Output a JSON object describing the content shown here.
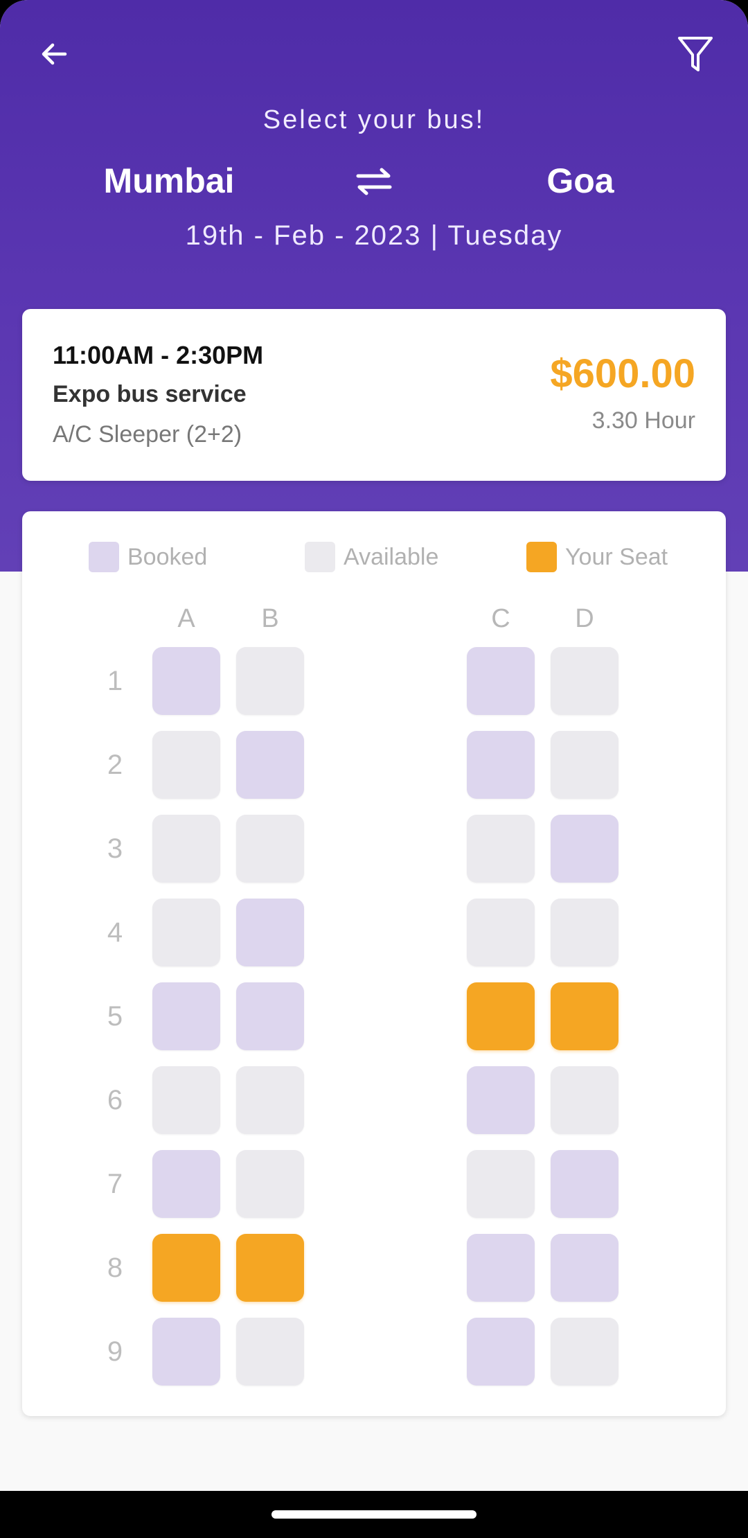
{
  "header": {
    "subtitle": "Select your bus!",
    "from_city": "Mumbai",
    "to_city": "Goa",
    "date": "19th - Feb - 2023 | Tuesday",
    "icons": {
      "back": "arrow-left-icon",
      "filter": "filter-icon",
      "swap": "swap-arrows-icon"
    }
  },
  "bus_card": {
    "time": "11:00AM - 2:30PM",
    "operator": "Expo bus service",
    "type": "A/C Sleeper (2+2)",
    "price": "$600.00",
    "duration": "3.30 Hour"
  },
  "legend": [
    {
      "label": "Booked",
      "status": "booked"
    },
    {
      "label": "Available",
      "status": "available"
    },
    {
      "label": "Your Seat",
      "status": "your"
    }
  ],
  "colors": {
    "header": "#4f2ca8",
    "booked": "#ddd6ee",
    "available": "#ebeaee",
    "your_seat": "#f5a623",
    "price": "#f5a623"
  },
  "seat_map": {
    "columns": [
      "A",
      "B",
      "C",
      "D"
    ],
    "rows": [
      {
        "label": "1",
        "seats": [
          "booked",
          "available",
          "booked",
          "available"
        ]
      },
      {
        "label": "2",
        "seats": [
          "available",
          "booked",
          "booked",
          "available"
        ]
      },
      {
        "label": "3",
        "seats": [
          "available",
          "available",
          "available",
          "booked"
        ]
      },
      {
        "label": "4",
        "seats": [
          "available",
          "booked",
          "available",
          "available"
        ]
      },
      {
        "label": "5",
        "seats": [
          "booked",
          "booked",
          "your",
          "your"
        ]
      },
      {
        "label": "6",
        "seats": [
          "available",
          "available",
          "booked",
          "available"
        ]
      },
      {
        "label": "7",
        "seats": [
          "booked",
          "available",
          "available",
          "booked"
        ]
      },
      {
        "label": "8",
        "seats": [
          "your",
          "your",
          "booked",
          "booked"
        ]
      },
      {
        "label": "9",
        "seats": [
          "booked",
          "available",
          "booked",
          "available"
        ]
      }
    ]
  }
}
